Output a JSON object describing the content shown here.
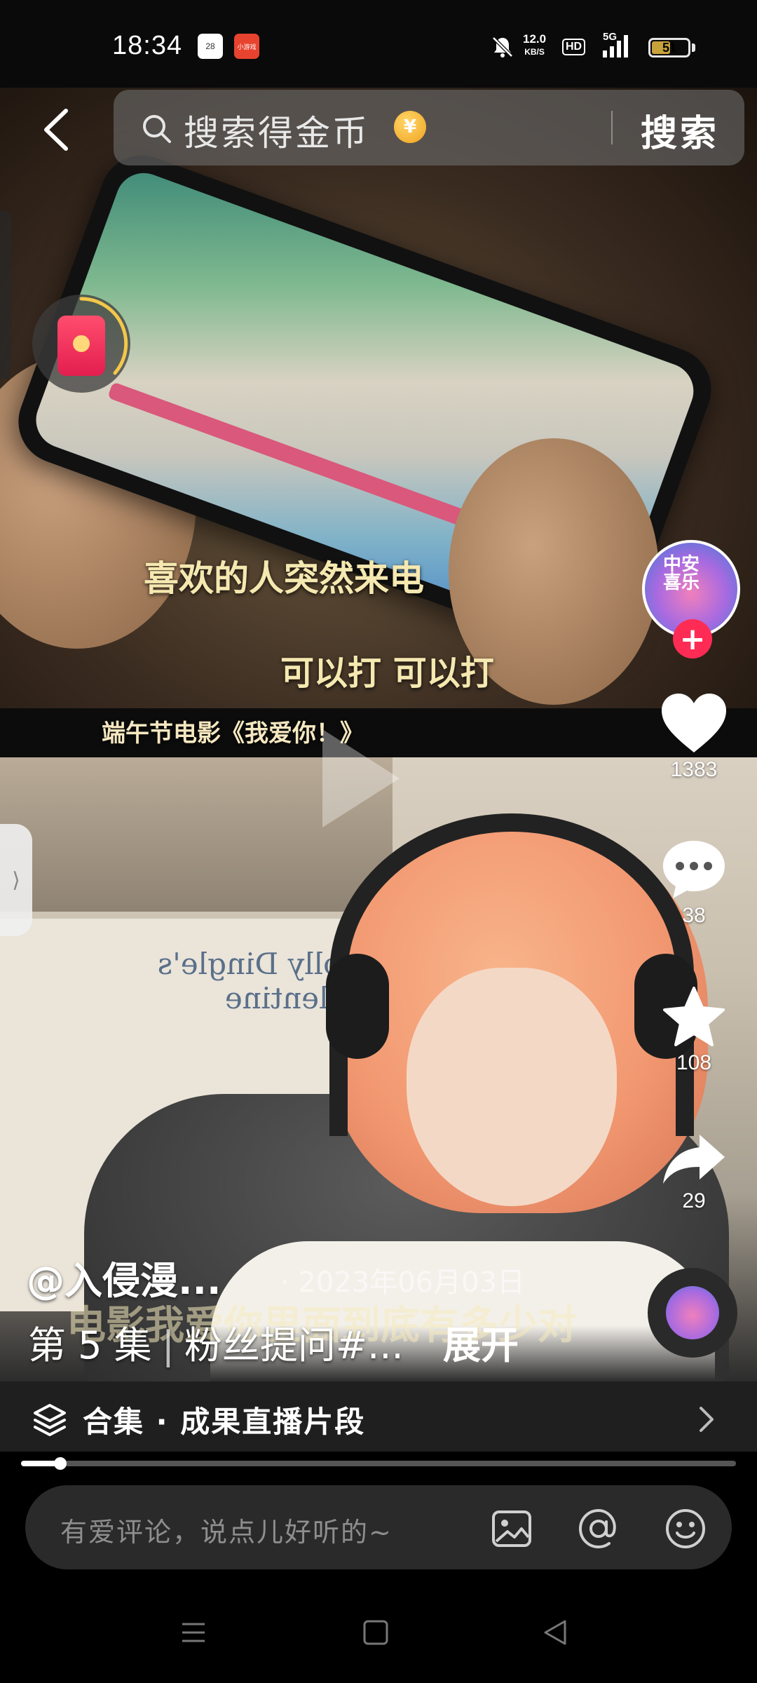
{
  "status_bar": {
    "time": "18:34",
    "calendar_day": "28",
    "app_badge": "小游戏",
    "net_speed_value": "12.0",
    "net_speed_unit": "KB/S",
    "hd": "HD",
    "network": "5G",
    "battery": "51"
  },
  "search": {
    "placeholder": "搜索得金币",
    "coin_symbol": "¥",
    "button_label": "搜索"
  },
  "video": {
    "subtitle_top": "喜欢的人突然来电",
    "subtitle_mid": "可以打 可以打",
    "movie_caption": "端午节电影《我爱你！》",
    "poster_title": "Dolly Dingle's Valentine",
    "overlay_caption": "电影我爱你里面到底有多少对"
  },
  "author": {
    "avatar_text": "中安\n喜乐",
    "follow_symbol": "+",
    "name": "@入侵漫...",
    "date": "· 2023年06月03日"
  },
  "actions": {
    "like_count": "1383",
    "comment_count": "38",
    "favorite_count": "108",
    "share_count": "29"
  },
  "post": {
    "episode": "第 5 集",
    "separator": "|",
    "description": "粉丝提问#...",
    "expand_label": "展开"
  },
  "collection": {
    "label": "合集 · 成果直播片段"
  },
  "playback": {
    "progress_percent": 5.5
  },
  "comment": {
    "placeholder": "有爱评论，说点儿好听的~"
  },
  "colors": {
    "accent_red": "#fe2c55",
    "coin_gold": "#f0a21e"
  }
}
